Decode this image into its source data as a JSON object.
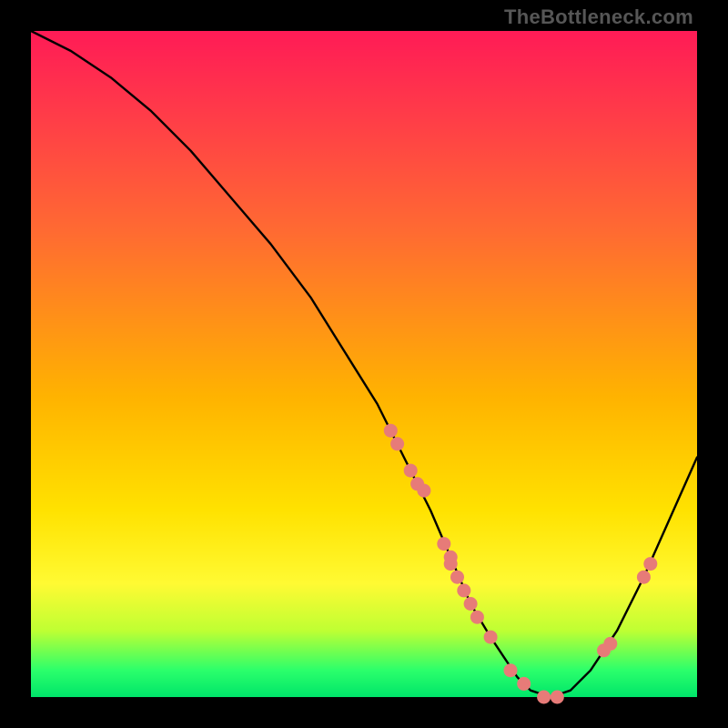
{
  "watermark": "TheBottleneck.com",
  "colors": {
    "dot": "#e77b78",
    "curve": "#000000",
    "gradient_top": "#ff1b56",
    "gradient_bottom": "#00e56a"
  },
  "chart_data": {
    "type": "line",
    "title": "",
    "xlabel": "",
    "ylabel": "",
    "xlim": [
      0,
      100
    ],
    "ylim": [
      0,
      100
    ],
    "grid": false,
    "legend": false,
    "description": "V-shaped bottleneck curve on rainbow gradient background. Y-axis is % bottleneck (top of gradient ~100%, bottom ~0%). Curve has scattered data-point dots (coral) along the descending arm, the trough, and the ascending arm. No axes, ticks, or labels are rendered.",
    "series": [
      {
        "name": "curve",
        "x": [
          0,
          6,
          12,
          18,
          24,
          30,
          36,
          42,
          47,
          52,
          56,
          60,
          63,
          66,
          69,
          71,
          73,
          75,
          78,
          81,
          84,
          88,
          92,
          96,
          100
        ],
        "y": [
          100,
          97,
          93,
          88,
          82,
          75,
          68,
          60,
          52,
          44,
          36,
          28,
          21,
          14,
          9,
          6,
          3,
          1,
          0,
          1,
          4,
          10,
          18,
          27,
          36
        ]
      },
      {
        "name": "data-points",
        "x": [
          54,
          55,
          57,
          58,
          59,
          62,
          63,
          63,
          64,
          65,
          66,
          67,
          69,
          72,
          74,
          77,
          79,
          86,
          87,
          92,
          93
        ],
        "y": [
          40,
          38,
          34,
          32,
          31,
          23,
          21,
          20,
          18,
          16,
          14,
          12,
          9,
          4,
          2,
          0,
          0,
          7,
          8,
          18,
          20
        ]
      }
    ]
  }
}
